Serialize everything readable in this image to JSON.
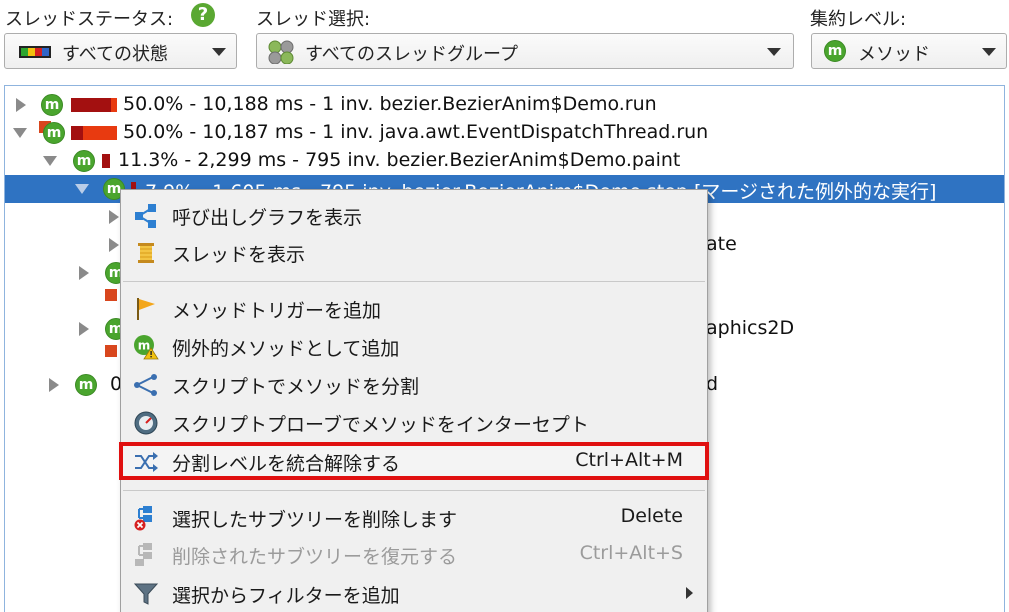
{
  "controls": {
    "thread_status_label": "スレッドステータス:",
    "thread_status_value": "すべての状態",
    "help_glyph": "?",
    "thread_select_label": "スレッド選択:",
    "thread_select_value": "すべてのスレッドグループ",
    "agg_level_label": "集約レベル:",
    "agg_level_value": "メソッド",
    "method_glyph": "m"
  },
  "tree": {
    "rows": [
      {
        "text": "50.0% - 10,188 ms - 1 inv. bezier.BezierAnim$Demo.run"
      },
      {
        "text": "50.0% - 10,187 ms - 1 inv. java.awt.EventDispatchThread.run"
      },
      {
        "text": "11.3% - 2,299 ms - 795 inv. bezier.BezierAnim$Demo.paint"
      },
      {
        "text": "7.9% - 1,605 ms - 795 inv. bezier.BezierAnim$Demo.step [マージされた例外的な実行]"
      },
      {
        "text": "ate"
      },
      {
        "text": "aphics2D"
      },
      {
        "text": "0",
        "suffix": "d"
      }
    ]
  },
  "context_menu": {
    "items": [
      {
        "label": "呼び出しグラフを表示",
        "shortcut": ""
      },
      {
        "label": "スレッドを表示",
        "shortcut": ""
      },
      {
        "label": "メソッドトリガーを追加",
        "shortcut": ""
      },
      {
        "label": "例外的メソッドとして追加",
        "shortcut": ""
      },
      {
        "label": "スクリプトでメソッドを分割",
        "shortcut": ""
      },
      {
        "label": "スクリプトプローブでメソッドをインターセプト",
        "shortcut": ""
      },
      {
        "label": "分割レベルを統合解除する",
        "shortcut": "Ctrl+Alt+M"
      },
      {
        "label": "選択したサブツリーを削除します",
        "shortcut": "Delete"
      },
      {
        "label": "削除されたサブツリーを復元する",
        "shortcut": "Ctrl+Alt+S"
      },
      {
        "label": "選択からフィルターを追加",
        "shortcut": ""
      }
    ]
  },
  "colors": {
    "selection": "#2f73c2",
    "highlight_border": "#e01010",
    "method_icon": "#4aa52e",
    "bar_dark_red": "#a31010",
    "bar_red": "#e83a10"
  }
}
